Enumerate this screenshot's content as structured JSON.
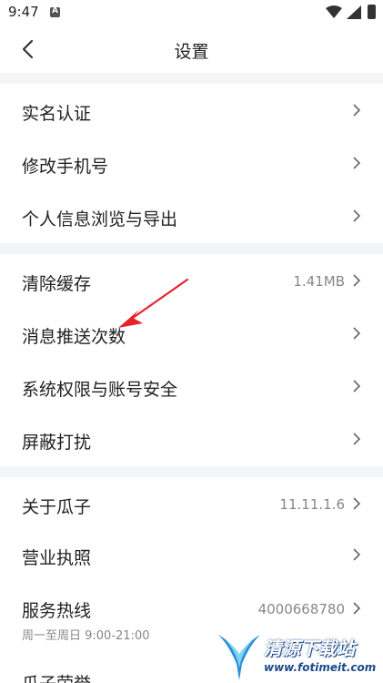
{
  "status_bar": {
    "time": "9:47"
  },
  "nav": {
    "title": "设置"
  },
  "groups": [
    {
      "items": [
        {
          "label": "实名认证"
        },
        {
          "label": "修改手机号"
        },
        {
          "label": "个人信息浏览与导出"
        }
      ]
    },
    {
      "items": [
        {
          "label": "清除缓存",
          "value": "1.41MB"
        },
        {
          "label": "消息推送次数"
        },
        {
          "label": "系统权限与账号安全"
        },
        {
          "label": "屏蔽打扰"
        }
      ]
    },
    {
      "items": [
        {
          "label": "关于瓜子",
          "value": "11.11.1.6"
        },
        {
          "label": "营业执照"
        },
        {
          "label": "服务热线",
          "value": "4000668780",
          "sub": "周一至周日 9:00-21:00"
        },
        {
          "label": "瓜子荣誉"
        }
      ]
    }
  ],
  "watermark": {
    "name": "清源下载站",
    "url": "www.fotimeit.com"
  },
  "colors": {
    "text": "#222222",
    "secondary": "#888888",
    "divider_band": "#f4f5f6",
    "annotation_arrow": "#e8222a"
  }
}
